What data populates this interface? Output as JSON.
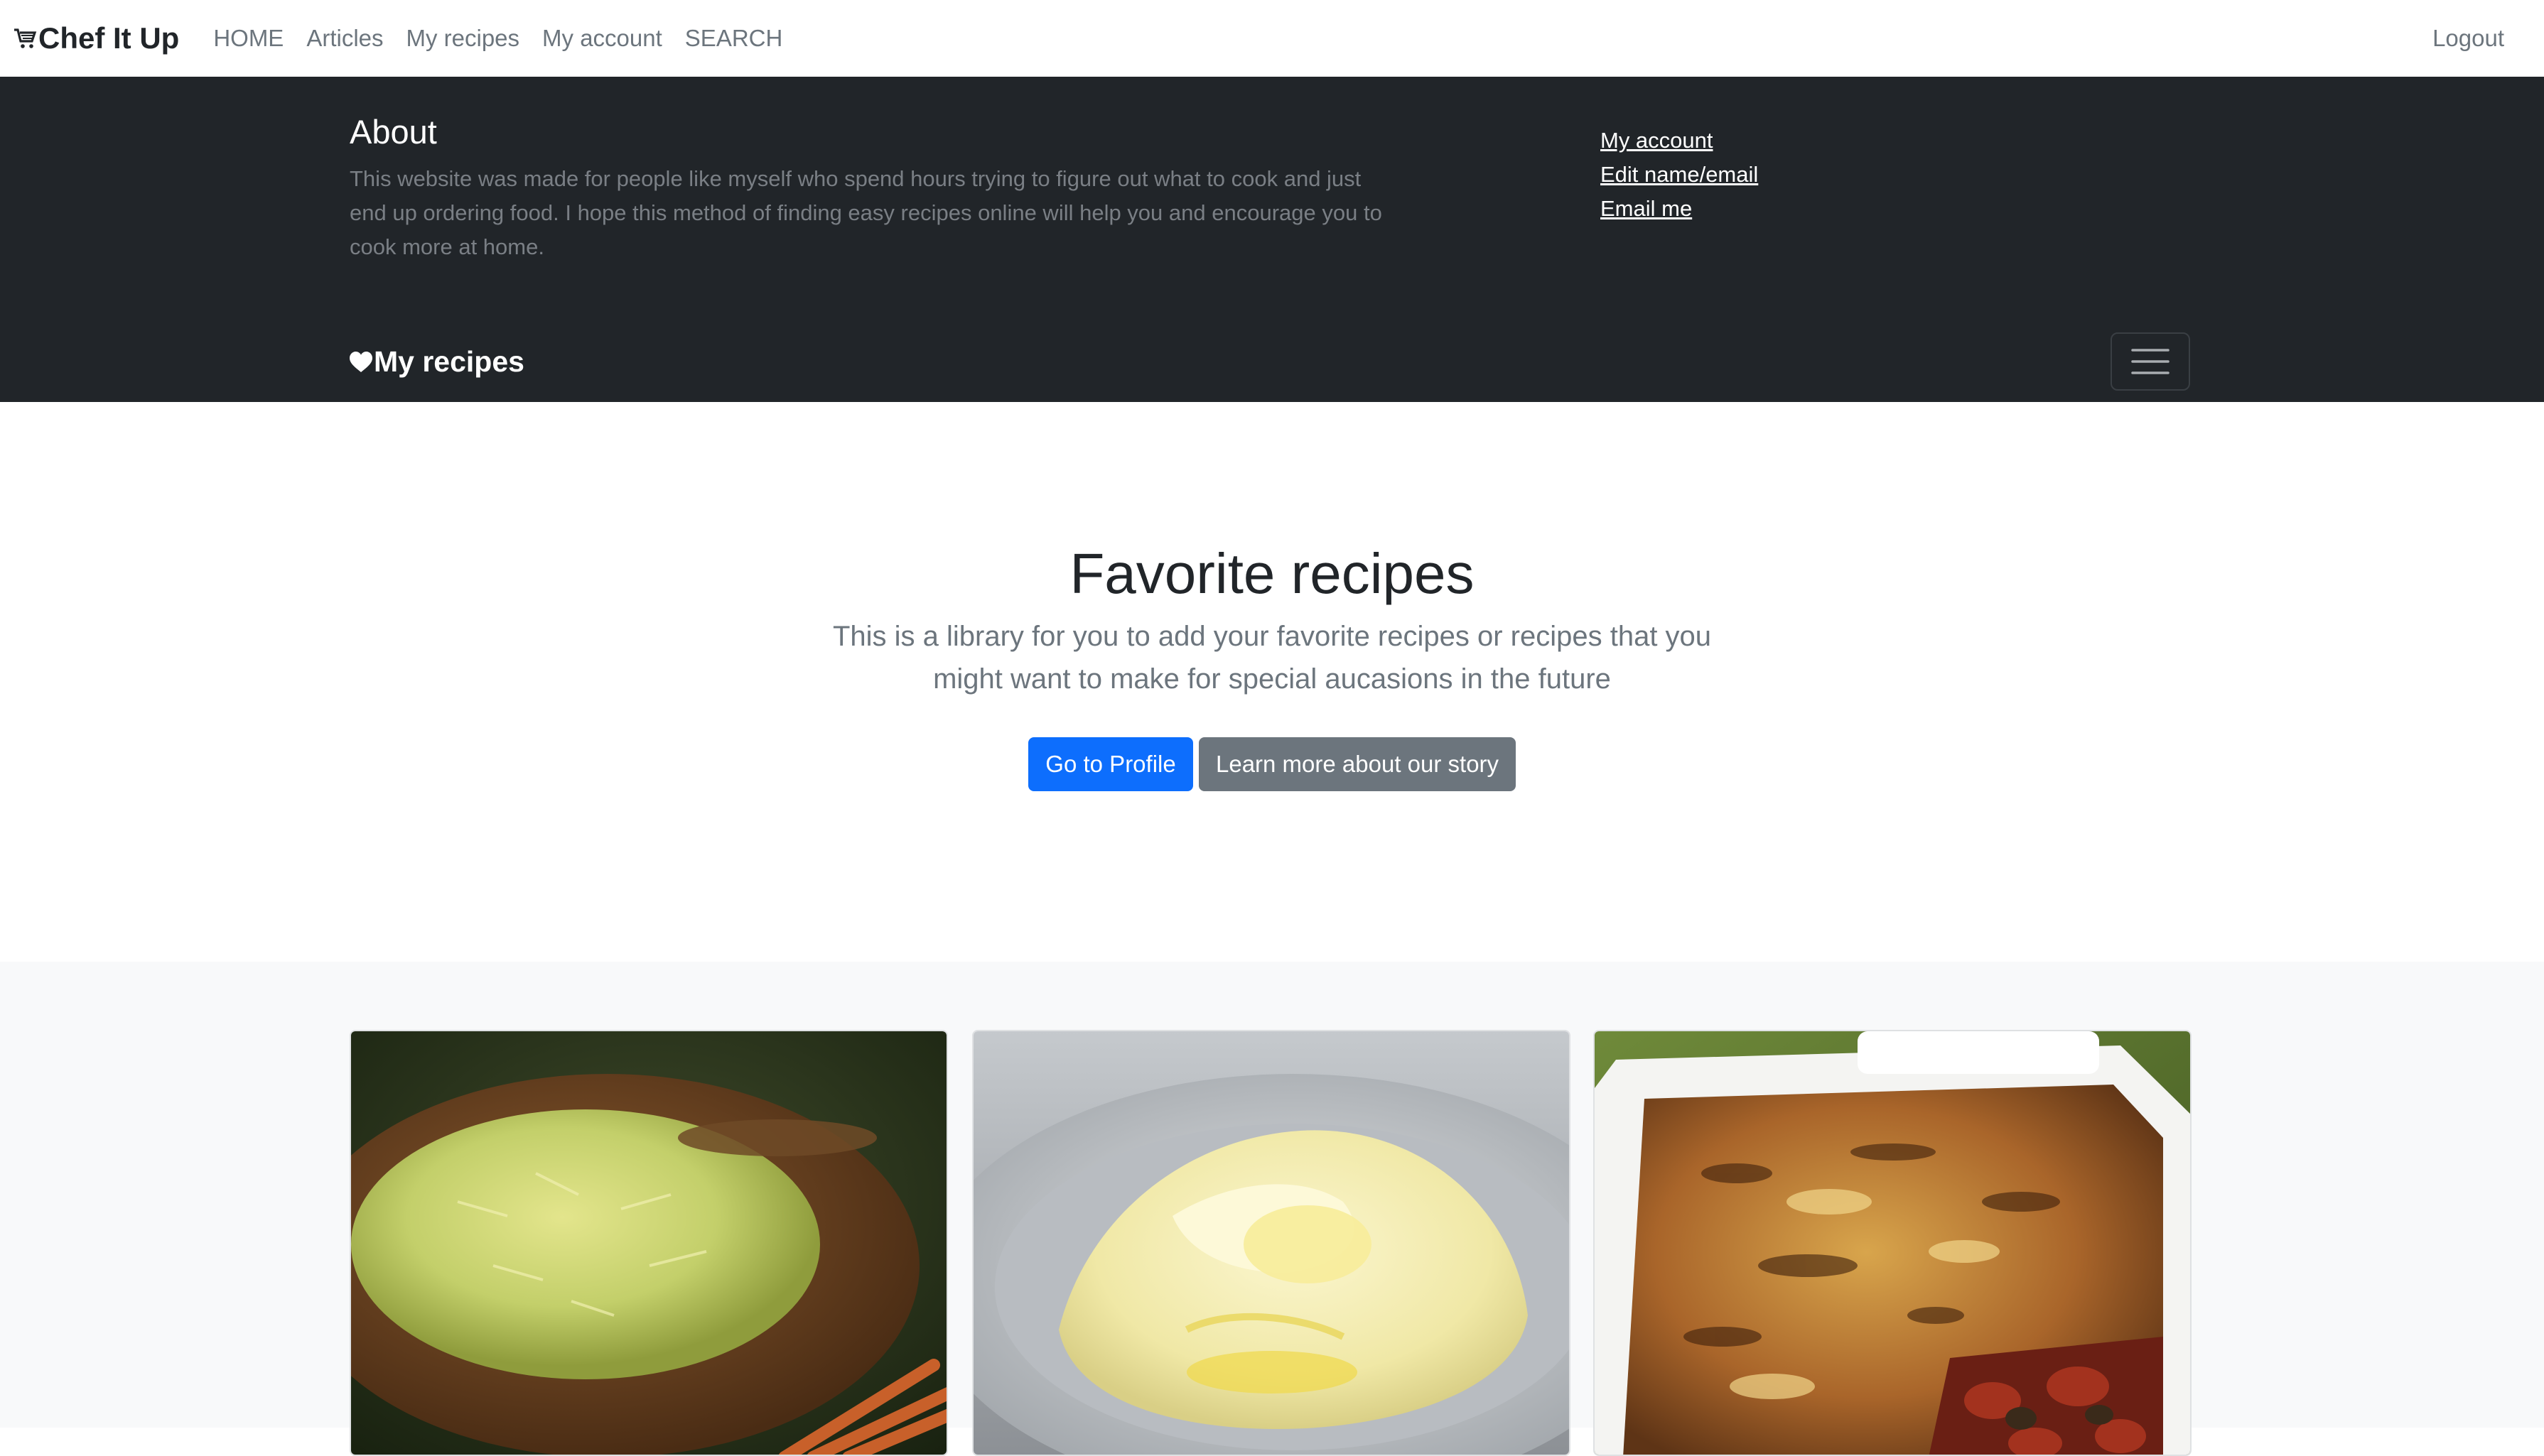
{
  "navbar": {
    "brand": "Chef It Up",
    "links": [
      "HOME",
      "Articles",
      "My recipes",
      "My account",
      "SEARCH"
    ],
    "logout": "Logout"
  },
  "header": {
    "about_title": "About",
    "about_text": "This website was made for people like myself who spend hours trying to figure out what to cook and just end up ordering food. I hope this method of finding easy recipes online will help you and encourage you to cook more at home.",
    "side_links": [
      "My account",
      "Edit name/email",
      "Email me"
    ],
    "brand": "My recipes"
  },
  "hero": {
    "title": "Favorite recipes",
    "lead": "This is a library for you to add your favorite recipes or recipes that you might want to make for special aucasions in the future",
    "primary_button": "Go to Profile",
    "secondary_button": "Learn more about our story"
  },
  "cards": [
    {
      "image": "cabbage-salad-photo"
    },
    {
      "image": "mashed-potatoes-photo"
    },
    {
      "image": "lasagna-photo"
    }
  ],
  "colors": {
    "dark_header": "#212529",
    "primary": "#0d6efd",
    "secondary": "#6c757d",
    "album_bg": "#f8f9fa"
  }
}
